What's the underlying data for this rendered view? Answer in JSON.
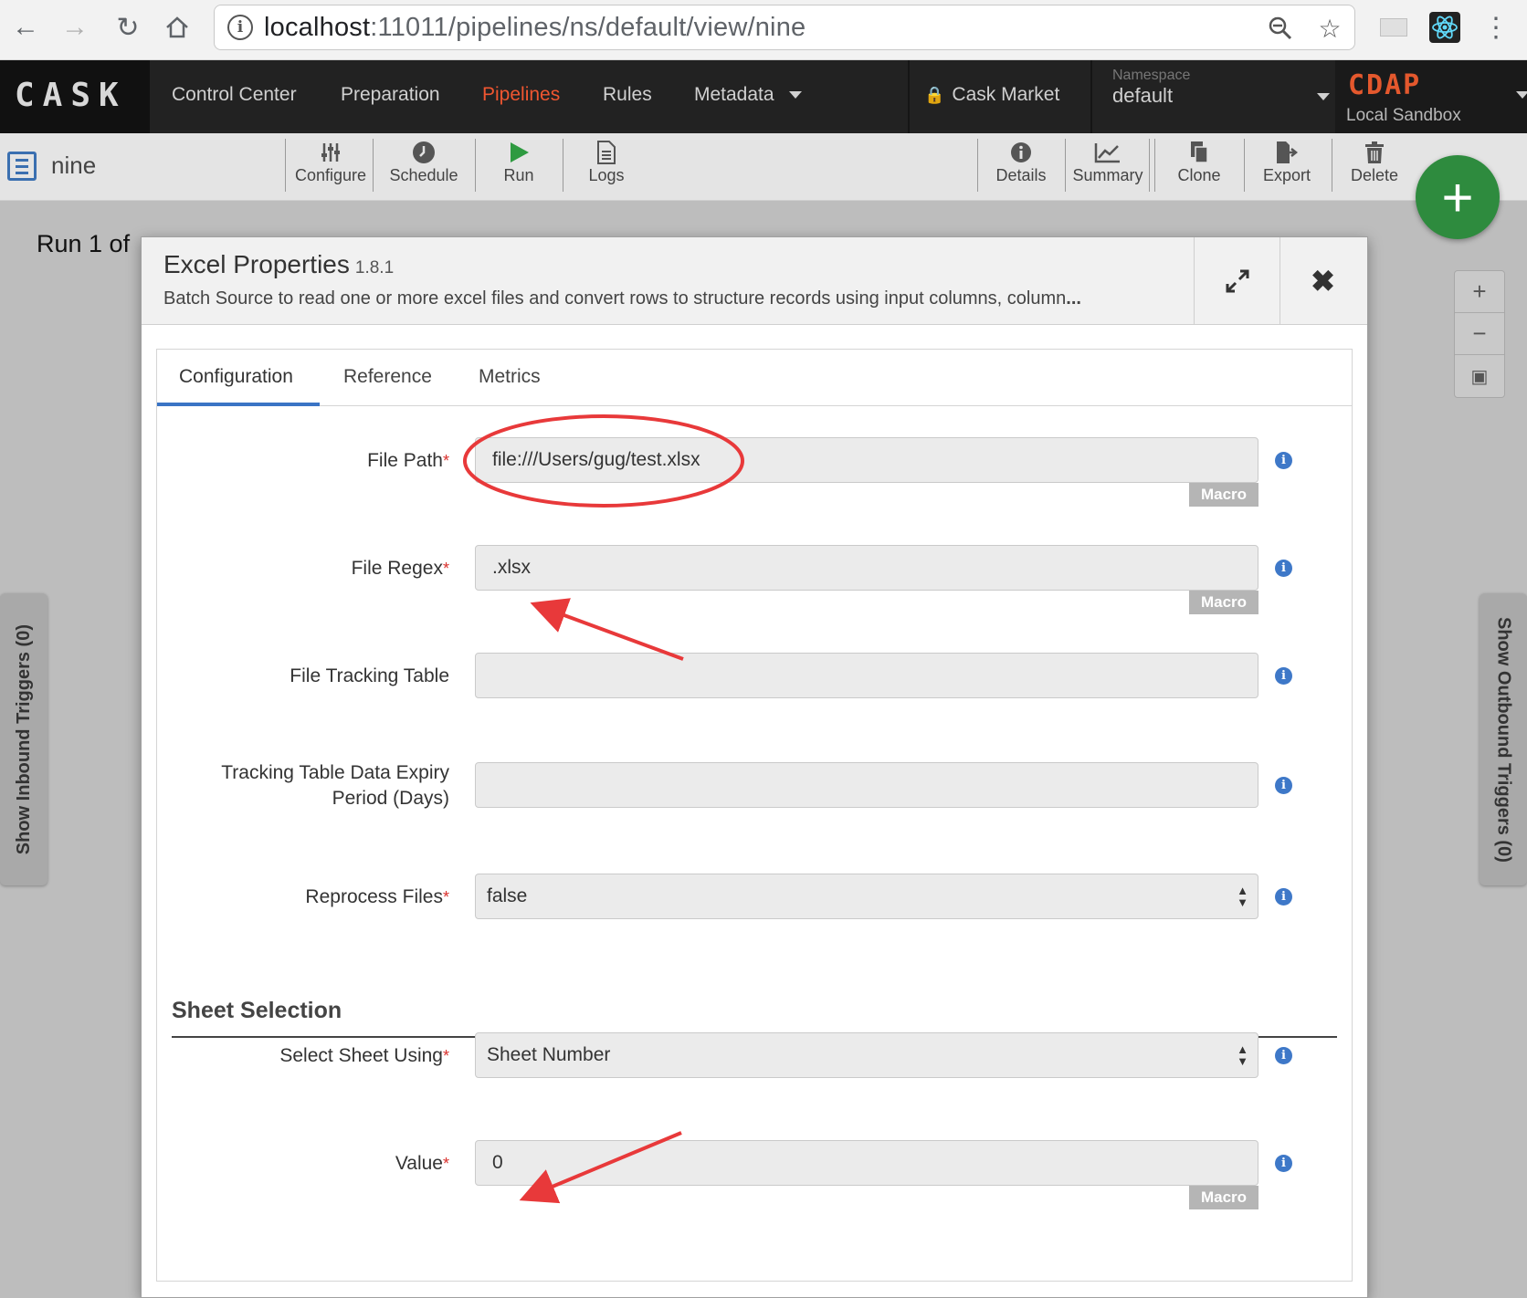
{
  "browser": {
    "url_host": "localhost",
    "url_rest": ":11011/pipelines/ns/default/view/nine"
  },
  "header": {
    "logo": "CASK",
    "nav": [
      "Control Center",
      "Preparation",
      "Pipelines",
      "Rules",
      "Metadata"
    ],
    "active_nav": "Pipelines",
    "market": "Cask Market",
    "namespace_label": "Namespace",
    "namespace_value": "default",
    "product_logo": "CDAP",
    "product_sub": "Local Sandbox"
  },
  "toolbar": {
    "pipeline_name": "nine",
    "left_buttons": [
      {
        "label": "Configure",
        "icon": "sliders-icon"
      },
      {
        "label": "Schedule",
        "icon": "clock-icon"
      },
      {
        "label": "Run",
        "icon": "play-icon"
      },
      {
        "label": "Logs",
        "icon": "document-icon"
      }
    ],
    "right_buttons": [
      {
        "label": "Details",
        "icon": "info-icon"
      },
      {
        "label": "Summary",
        "icon": "chart-icon"
      },
      {
        "label": "Clone",
        "icon": "copy-icon"
      },
      {
        "label": "Export",
        "icon": "export-icon"
      },
      {
        "label": "Delete",
        "icon": "trash-icon"
      }
    ]
  },
  "canvas": {
    "run_text": "Run 1 of",
    "inbound_triggers": "Show Inbound Triggers (0)",
    "outbound_triggers": "Show Outbound Triggers (0)"
  },
  "modal": {
    "title": "Excel Properties",
    "version": "1.8.1",
    "description": "Batch Source to read one or more excel files and convert rows to structure records using input columns, column",
    "ellipsis": "...",
    "tabs": [
      "Configuration",
      "Reference",
      "Metrics"
    ],
    "active_tab": "Configuration",
    "macro_label": "Macro",
    "fields": {
      "file_path": {
        "label": "File Path",
        "value": "file:///Users/gug/test.xlsx"
      },
      "file_regex": {
        "label": "File Regex",
        "value": ".xlsx"
      },
      "file_tracking_table": {
        "label": "File Tracking Table",
        "value": ""
      },
      "expiry_line1": "Tracking Table Data Expiry",
      "expiry_line2": "Period (Days)",
      "reprocess_files": {
        "label": "Reprocess Files",
        "value": "false"
      },
      "select_sheet_using": {
        "label": "Select Sheet Using",
        "value": "Sheet Number"
      },
      "value": {
        "label": "Value",
        "value": "0"
      }
    },
    "section_sheet_selection": "Sheet Selection"
  },
  "colors": {
    "accent_active_nav": "#f05630",
    "annotation_red": "#e8393a",
    "fab_green": "#2e8b3e",
    "info_blue": "#3e78c8"
  }
}
